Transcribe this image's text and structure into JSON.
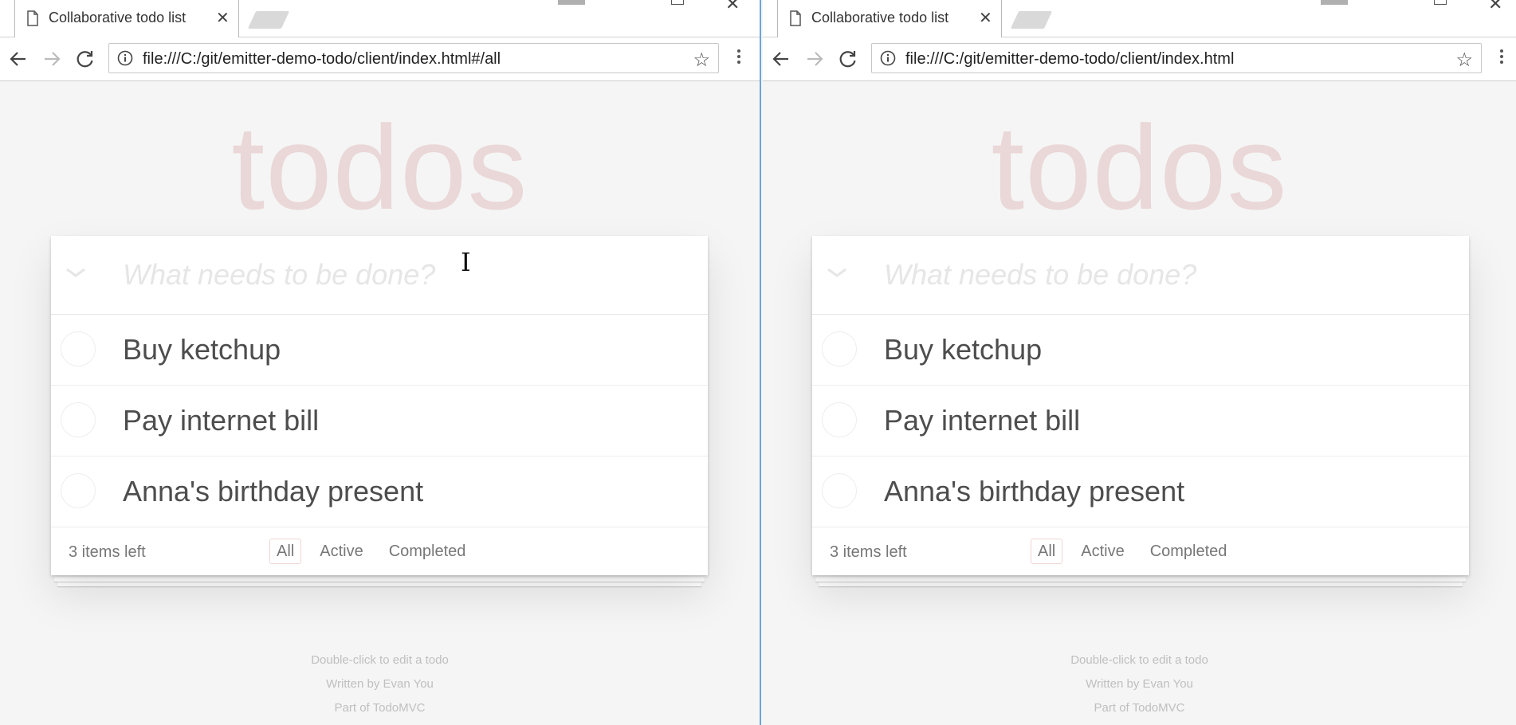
{
  "windows": [
    {
      "tab_title": "Collaborative todo list",
      "url": "file:///C:/git/emitter-demo-todo/client/index.html#/all",
      "app": {
        "title": "todos",
        "new_todo_placeholder": "What needs to be done?",
        "todos": [
          {
            "label": "Buy ketchup",
            "completed": false
          },
          {
            "label": "Pay internet bill",
            "completed": false
          },
          {
            "label": "Anna's birthday present",
            "completed": false
          }
        ],
        "items_left": "3 items left",
        "filters": [
          {
            "label": "All",
            "selected": true
          },
          {
            "label": "Active",
            "selected": false
          },
          {
            "label": "Completed",
            "selected": false
          }
        ],
        "info": [
          "Double-click to edit a todo",
          "Written by Evan You",
          "Part of TodoMVC"
        ]
      }
    },
    {
      "tab_title": "Collaborative todo list",
      "url": "file:///C:/git/emitter-demo-todo/client/index.html",
      "app": {
        "title": "todos",
        "new_todo_placeholder": "What needs to be done?",
        "todos": [
          {
            "label": "Buy ketchup",
            "completed": false
          },
          {
            "label": "Pay internet bill",
            "completed": false
          },
          {
            "label": "Anna's birthday present",
            "completed": false
          }
        ],
        "items_left": "3 items left",
        "filters": [
          {
            "label": "All",
            "selected": true
          },
          {
            "label": "Active",
            "selected": false
          },
          {
            "label": "Completed",
            "selected": false
          }
        ],
        "info": [
          "Double-click to edit a todo",
          "Written by Evan You",
          "Part of TodoMVC"
        ]
      }
    }
  ],
  "icons": {
    "tab": "page-icon",
    "close": "close-icon",
    "back": "back-arrow-icon",
    "forward": "forward-arrow-icon",
    "reload": "reload-icon",
    "info": "info-icon",
    "bookmark": "star-icon",
    "menu": "menu-dots-icon",
    "toggle_all": "chevron-down-icon"
  },
  "colors": {
    "title": "#af2f2f",
    "page_bg": "#f5f5f5",
    "text": "#4d4d4d",
    "window_divider": "#6aa6d8"
  }
}
